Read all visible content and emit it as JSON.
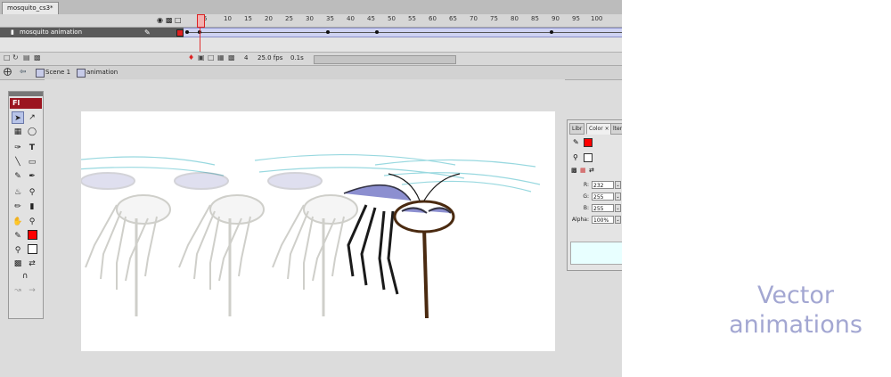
{
  "document_tab": {
    "label": "mosquito_cs3*"
  },
  "timeline": {
    "frame_numbers": [
      "5",
      "10",
      "15",
      "20",
      "25",
      "30",
      "35",
      "40",
      "45",
      "50",
      "55",
      "60",
      "65",
      "70",
      "75",
      "80",
      "85",
      "90",
      "95",
      "100"
    ],
    "current_frame_marker": "1",
    "layer": {
      "name": "mosquito animation",
      "color": "#e02020"
    },
    "footer": {
      "frame": "4",
      "fps": "25.0 fps",
      "time": "0.1s"
    }
  },
  "breadcrumb": {
    "scene": "Scene 1",
    "symbol": "animation"
  },
  "tools": {
    "logo": "Fl",
    "fill_color": "#ff0000"
  },
  "color_panel": {
    "tabs": [
      "Libr",
      "Color",
      "lters"
    ],
    "close": "×",
    "fields": [
      {
        "label": "R:",
        "value": "232"
      },
      {
        "label": "G:",
        "value": "255"
      },
      {
        "label": "B:",
        "value": "255"
      },
      {
        "label": "Alpha:",
        "value": "100%"
      }
    ],
    "preview_color": "#e8ffff"
  },
  "caption": {
    "line1": "Vector",
    "line2": "animations"
  }
}
